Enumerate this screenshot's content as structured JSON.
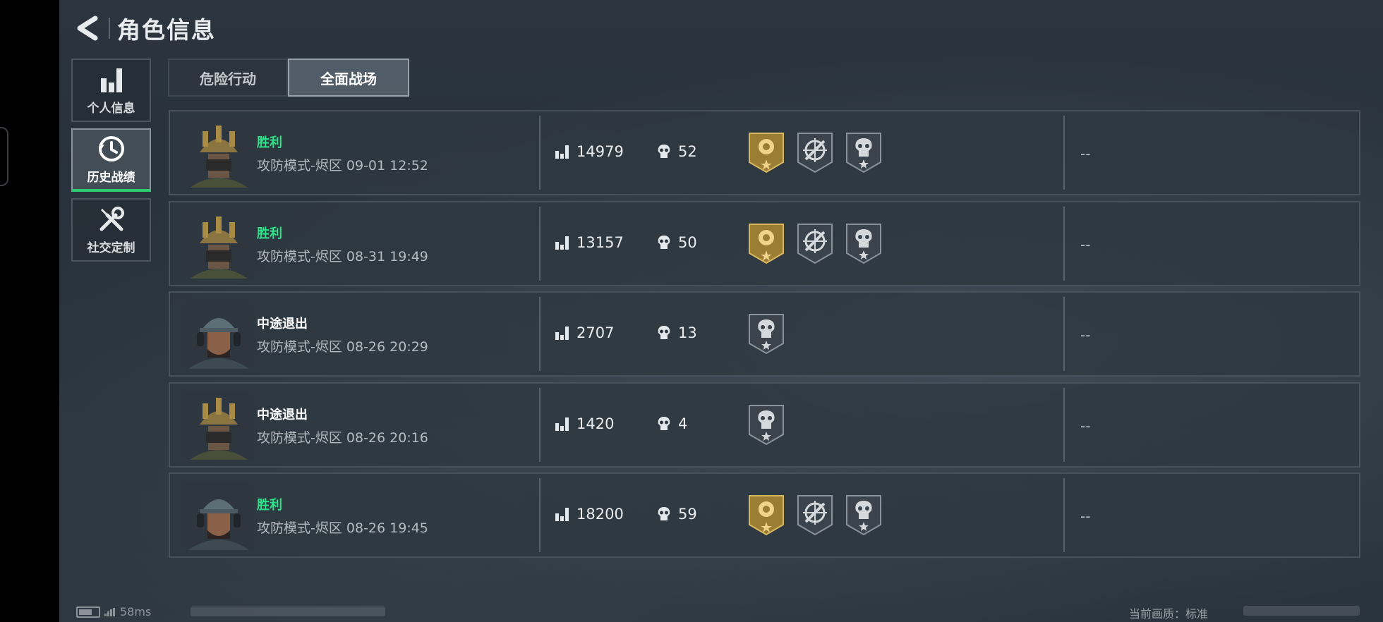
{
  "header": {
    "title": "角色信息"
  },
  "side_nav": {
    "items": [
      {
        "label": "个人信息",
        "icon": "bar-chart-icon",
        "active": false
      },
      {
        "label": "历史战绩",
        "icon": "history-clock-icon",
        "active": true
      },
      {
        "label": "社交定制",
        "icon": "tools-icon",
        "active": false
      }
    ]
  },
  "tabs": [
    {
      "label": "危险行动",
      "active": false
    },
    {
      "label": "全面战场",
      "active": true
    }
  ],
  "matches": [
    {
      "result": "胜利",
      "result_type": "win",
      "mode": "攻防模式-烬区 09-01 12:52",
      "score": "14979",
      "kills": "52",
      "medals": [
        "gold-rose-medal-icon",
        "crosshair-medal-icon",
        "skull-medal-icon"
      ],
      "extra": "--",
      "avatar": "gold-helmet-soldier"
    },
    {
      "result": "胜利",
      "result_type": "win",
      "mode": "攻防模式-烬区 08-31 19:49",
      "score": "13157",
      "kills": "50",
      "medals": [
        "gold-rose-medal-icon",
        "crosshair-medal-icon",
        "skull-medal-icon"
      ],
      "extra": "--",
      "avatar": "gold-helmet-soldier"
    },
    {
      "result": "中途退出",
      "result_type": "quit",
      "mode": "攻防模式-烬区 08-26 20:29",
      "score": "2707",
      "kills": "13",
      "medals": [
        "skull-medal-icon"
      ],
      "extra": "--",
      "avatar": "cap-headset-soldier"
    },
    {
      "result": "中途退出",
      "result_type": "quit",
      "mode": "攻防模式-烬区 08-26 20:16",
      "score": "1420",
      "kills": "4",
      "medals": [
        "skull-medal-icon"
      ],
      "extra": "--",
      "avatar": "gold-helmet-soldier"
    },
    {
      "result": "胜利",
      "result_type": "win",
      "mode": "攻防模式-烬区 08-26 19:45",
      "score": "18200",
      "kills": "59",
      "medals": [
        "gold-rose-medal-icon",
        "crosshair-medal-icon",
        "skull-medal-icon"
      ],
      "extra": "--",
      "avatar": "cap-headset-soldier"
    }
  ],
  "status_bar": {
    "ping": "58ms",
    "quality": "当前画质：标准"
  },
  "colors": {
    "win": "#2fe38a",
    "active_indicator": "#2ecc71",
    "gold_medal": "#c7a24a"
  }
}
